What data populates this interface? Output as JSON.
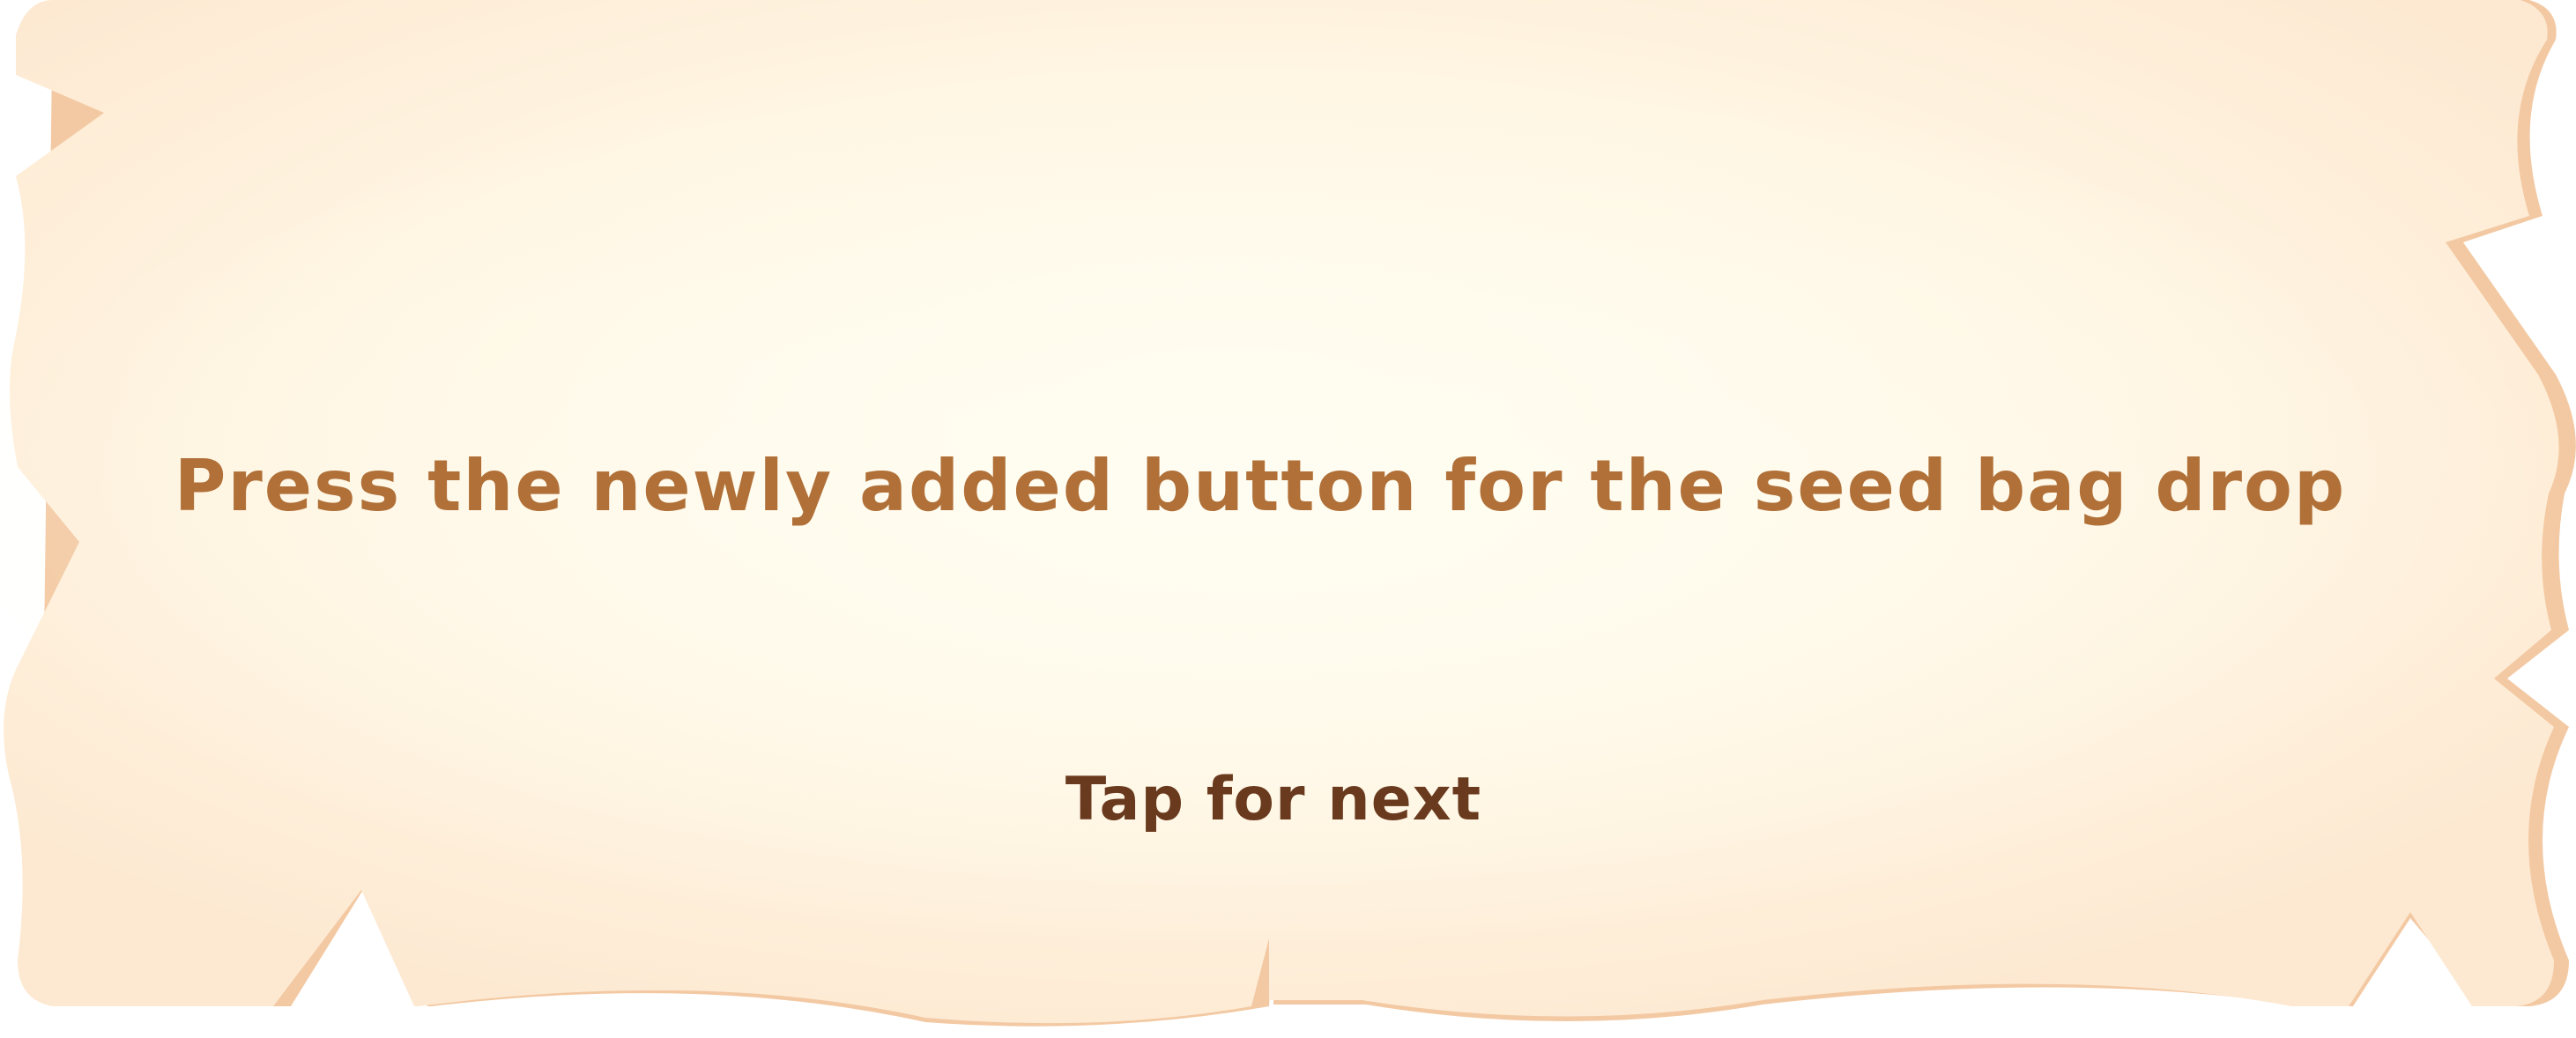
{
  "dialog": {
    "message": "Press the newly added button for the seed bag drop",
    "tap_prompt": "Tap for next"
  },
  "colors": {
    "parchment_light": "#fffbec",
    "parchment_mid": "#fef3de",
    "parchment_edge": "#fde9d2",
    "parchment_shadow": "#f3c9a3",
    "message_text": "#b07038",
    "prompt_text": "#6a3a1e"
  }
}
